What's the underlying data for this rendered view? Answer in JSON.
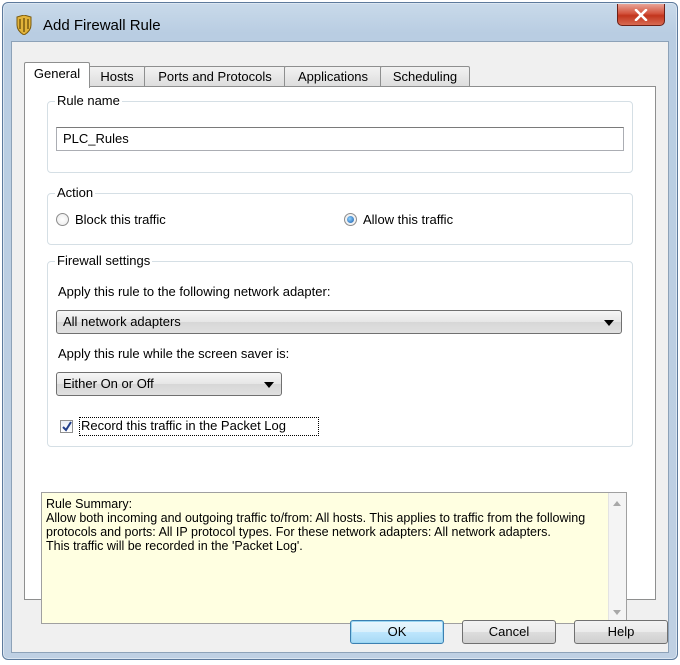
{
  "window": {
    "title": "Add Firewall Rule",
    "close_glyph": "✖"
  },
  "tabs": [
    {
      "label": "General",
      "active": true
    },
    {
      "label": "Hosts",
      "active": false
    },
    {
      "label": "Ports and Protocols",
      "active": false
    },
    {
      "label": "Applications",
      "active": false
    },
    {
      "label": "Scheduling",
      "active": false
    }
  ],
  "rule_name": {
    "legend": "Rule name",
    "value": "PLC_Rules"
  },
  "action": {
    "legend": "Action",
    "block_label": "Block this traffic",
    "allow_label": "Allow this traffic",
    "selected": "allow"
  },
  "firewall_settings": {
    "legend": "Firewall settings",
    "adapter_prompt": "Apply this rule to the following network adapter:",
    "adapter_value": "All network adapters",
    "screensaver_prompt": "Apply this rule while the screen saver is:",
    "screensaver_value": "Either On or Off",
    "record_label": "Record this traffic in the Packet Log",
    "record_checked": true
  },
  "summary": {
    "text": "Rule Summary:\nAllow both incoming and outgoing traffic to/from: All hosts. This applies to traffic from the following protocols and ports: All IP protocol types. For these network adapters: All network adapters.\nThis traffic will be recorded in the 'Packet Log'."
  },
  "buttons": {
    "ok": "OK",
    "cancel": "Cancel",
    "help": "Help"
  },
  "colors": {
    "summary_bg": "#ffffe1",
    "close_red": "#c2351d",
    "default_button_blue": "#3c7fb1"
  }
}
